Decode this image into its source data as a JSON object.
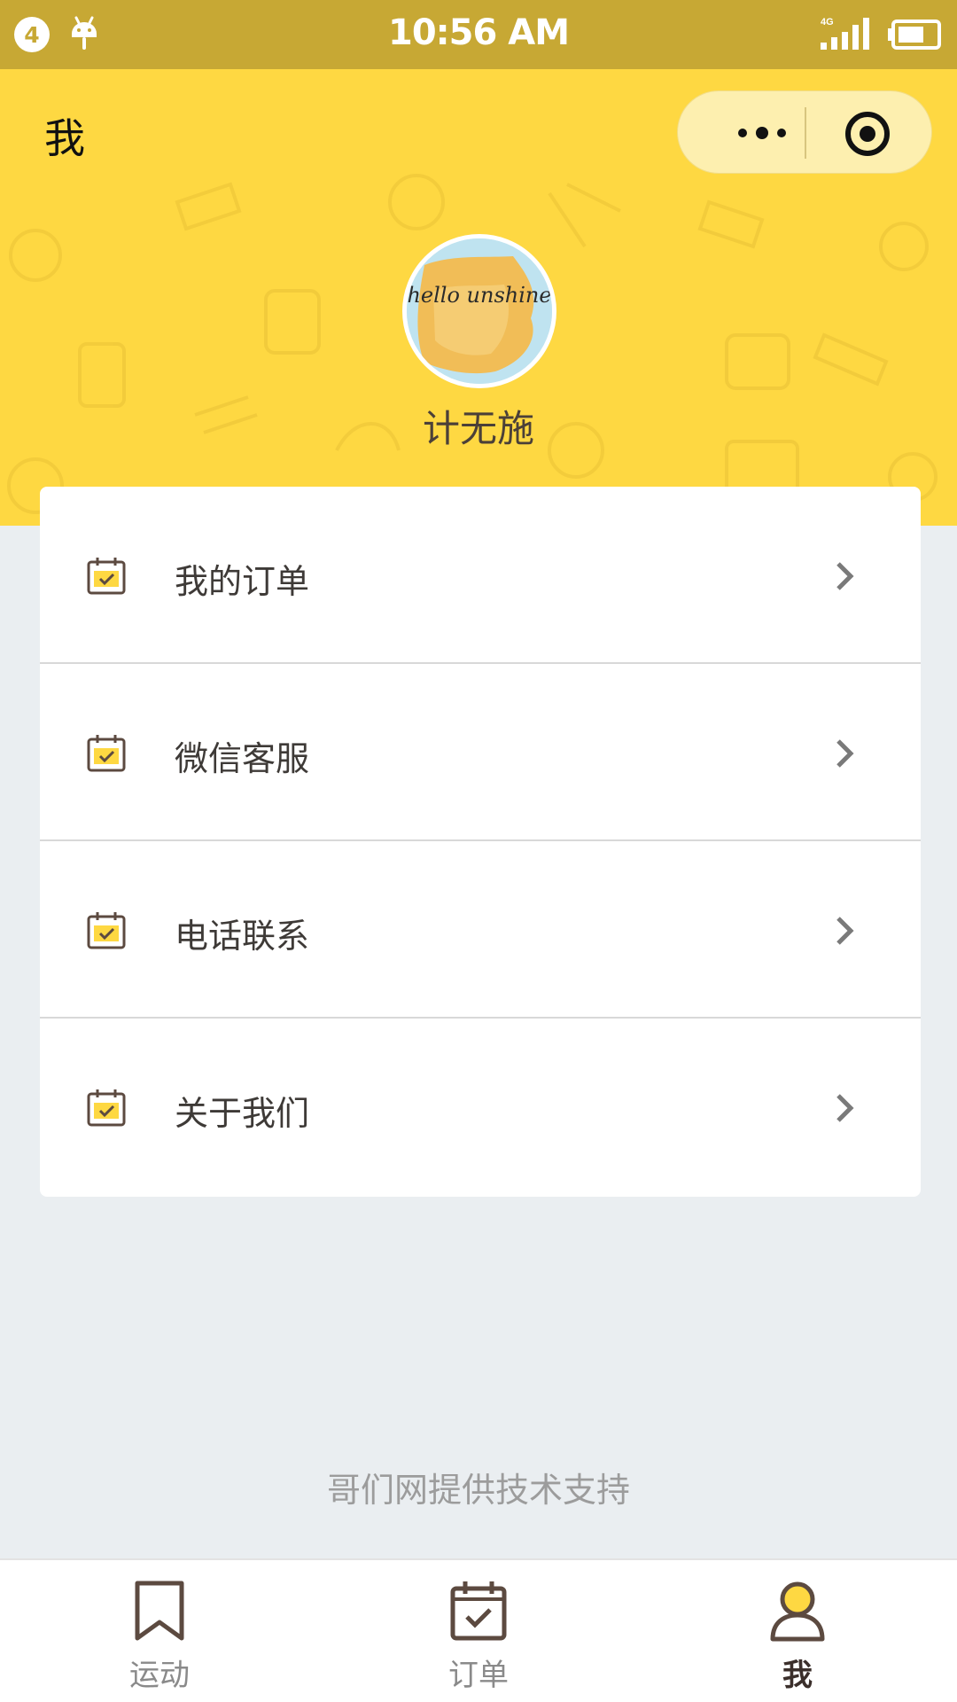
{
  "status_bar": {
    "notification_count": "4",
    "time": "10:56 AM",
    "network": "4G"
  },
  "header": {
    "title": "我",
    "username": "计无施",
    "avatar_text": "hello unshine",
    "accent_color": "#fed842"
  },
  "menu": {
    "items": [
      {
        "label": "我的订单",
        "icon": "calendar-check-icon"
      },
      {
        "label": "微信客服",
        "icon": "calendar-check-icon"
      },
      {
        "label": "电话联系",
        "icon": "calendar-check-icon"
      },
      {
        "label": "关于我们",
        "icon": "calendar-check-icon"
      }
    ]
  },
  "footer": {
    "note": "哥们网提供技术支持"
  },
  "tab_bar": {
    "tabs": [
      {
        "label": "运动",
        "icon": "bookmark-icon",
        "active": false
      },
      {
        "label": "订单",
        "icon": "calendar-check-icon",
        "active": false
      },
      {
        "label": "我",
        "icon": "user-icon",
        "active": true
      }
    ]
  }
}
